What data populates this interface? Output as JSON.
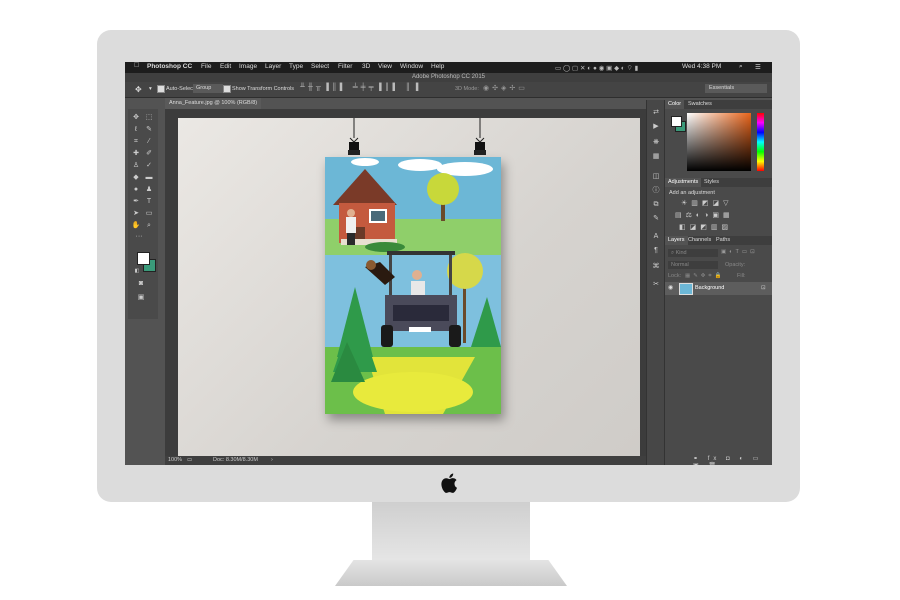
{
  "menubar": {
    "app_name": "Photoshop CC",
    "items": [
      "File",
      "Edit",
      "Image",
      "Layer",
      "Type",
      "Select",
      "Filter",
      "3D",
      "View",
      "Window",
      "Help"
    ],
    "clock": "Wed 4:38 PM"
  },
  "window": {
    "title": "Adobe Photoshop CC 2015"
  },
  "options": {
    "auto_select_label": "Auto-Select:",
    "auto_select_value": "Group",
    "show_transform_label": "Show Transform Controls",
    "mode_3d_label": "3D Mode:",
    "workspace": "Essentials"
  },
  "document": {
    "tab_title": "Anna_Feature.jpg @ 100% (RGB/8)",
    "zoom": "100%",
    "doc_info": "Doc: 8.30M/8.30M"
  },
  "panels": {
    "color_tabs": [
      "Color",
      "Swatches"
    ],
    "adjust_tabs": [
      "Adjustments",
      "Styles"
    ],
    "add_adjustment": "Add an adjustment",
    "layer_tabs": [
      "Layers",
      "Channels",
      "Paths"
    ],
    "kind_placeholder": "Kind",
    "blend_mode": "Normal",
    "opacity_label": "Opacity:",
    "lock_label": "Lock:",
    "fill_label": "Fill:",
    "layer_name": "Background"
  },
  "colors": {
    "foreground": "#ffffff",
    "background": "#3a9a7a"
  }
}
